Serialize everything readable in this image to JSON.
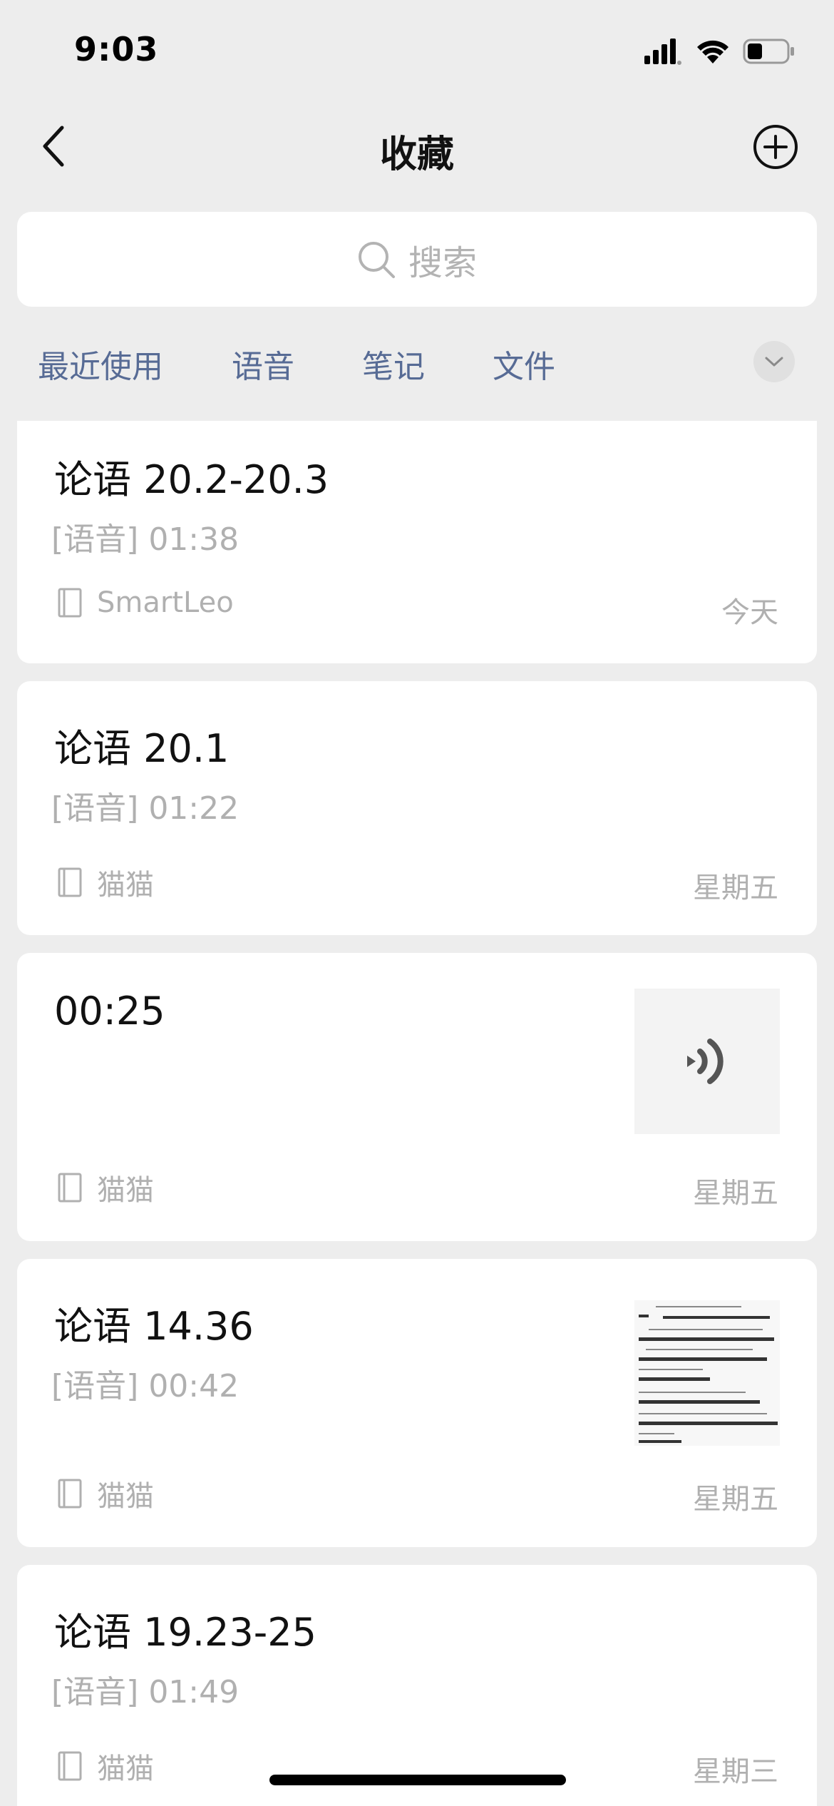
{
  "status_bar": {
    "time": "9:03"
  },
  "nav": {
    "title": "收藏"
  },
  "search": {
    "placeholder": "搜索"
  },
  "filters": [
    {
      "label": "最近使用"
    },
    {
      "label": "语音"
    },
    {
      "label": "笔记"
    },
    {
      "label": "文件"
    }
  ],
  "items": [
    {
      "title": "论语 20.2-20.3",
      "subtitle": "[语音] 01:38",
      "source": "SmartLeo",
      "date": "今天"
    },
    {
      "title": "论语 20.1",
      "subtitle": "[语音] 01:22",
      "source": "猫猫",
      "date": "星期五"
    },
    {
      "title": "00:25",
      "source": "猫猫",
      "date": "星期五",
      "thumbnail": "voice-icon"
    },
    {
      "title": "论语 14.36",
      "subtitle": "[语音] 00:42",
      "source": "猫猫",
      "date": "星期五",
      "thumbnail": "text-page-image"
    },
    {
      "title": "论语 19.23-25",
      "subtitle": "[语音] 01:49",
      "source": "猫猫",
      "date": "星期三"
    }
  ],
  "colors": {
    "background": "#ededed",
    "link": "#576b95",
    "muted": "#b0b0b0"
  }
}
